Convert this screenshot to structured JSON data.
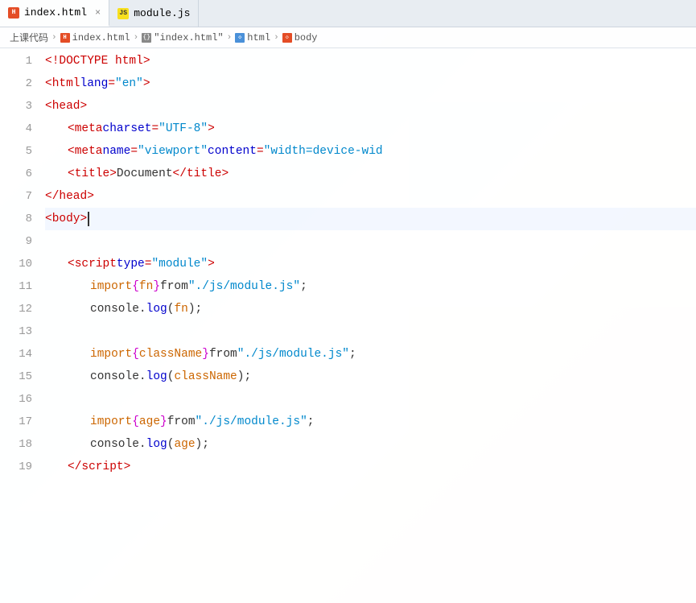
{
  "tabs": [
    {
      "id": "index-html",
      "icon": "html-icon",
      "label": "index.html",
      "active": true,
      "closeable": true
    },
    {
      "id": "module-js",
      "icon": "js-icon",
      "label": "module.js",
      "active": false,
      "closeable": false
    }
  ],
  "breadcrumb": {
    "items": [
      {
        "type": "text",
        "label": "上课代码"
      },
      {
        "type": "html-icon",
        "label": "index.html"
      },
      {
        "type": "curly-icon",
        "label": "\"index.html\""
      },
      {
        "type": "html2-icon",
        "label": "html"
      },
      {
        "type": "tag-icon",
        "label": "body"
      }
    ]
  },
  "lines": [
    {
      "num": 1,
      "content": "doctype"
    },
    {
      "num": 2,
      "content": "html-open"
    },
    {
      "num": 3,
      "content": "head-open"
    },
    {
      "num": 4,
      "content": "meta-charset"
    },
    {
      "num": 5,
      "content": "meta-viewport"
    },
    {
      "num": 6,
      "content": "title"
    },
    {
      "num": 7,
      "content": "head-close"
    },
    {
      "num": 8,
      "content": "body-open",
      "active": true
    },
    {
      "num": 9,
      "content": "empty"
    },
    {
      "num": 10,
      "content": "script-open"
    },
    {
      "num": 11,
      "content": "import-fn"
    },
    {
      "num": 12,
      "content": "console-fn"
    },
    {
      "num": 13,
      "content": "empty"
    },
    {
      "num": 14,
      "content": "import-classname"
    },
    {
      "num": 15,
      "content": "console-classname"
    },
    {
      "num": 16,
      "content": "empty"
    },
    {
      "num": 17,
      "content": "import-age"
    },
    {
      "num": 18,
      "content": "console-age"
    },
    {
      "num": 19,
      "content": "script-close"
    }
  ]
}
